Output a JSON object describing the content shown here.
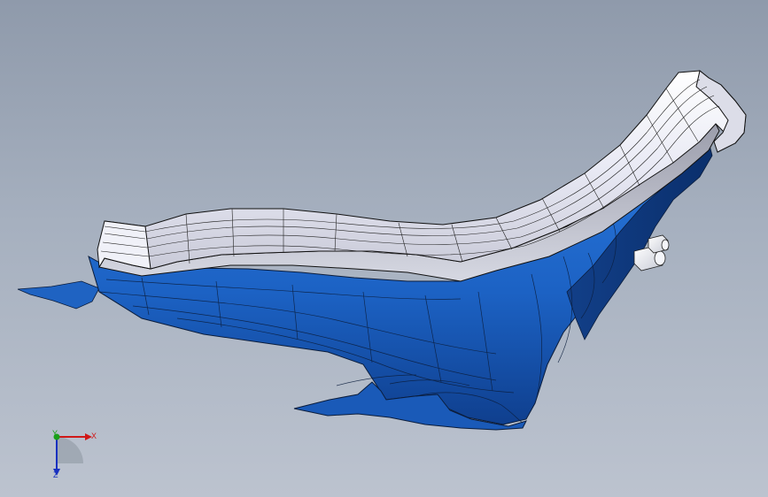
{
  "viewport": {
    "background_top": "#8f9aab",
    "background_bottom": "#bcc3cf"
  },
  "model": {
    "body_color": "#1e64c8",
    "body_shadow_color": "#0b3478",
    "flange_color": "#e4e6f0",
    "edge_color": "#111111"
  },
  "triad": {
    "x_label": "X",
    "y_label": "Y",
    "z_label": "Z",
    "x_color": "#d01818",
    "y_color": "#18a018",
    "z_color": "#1830c0"
  }
}
